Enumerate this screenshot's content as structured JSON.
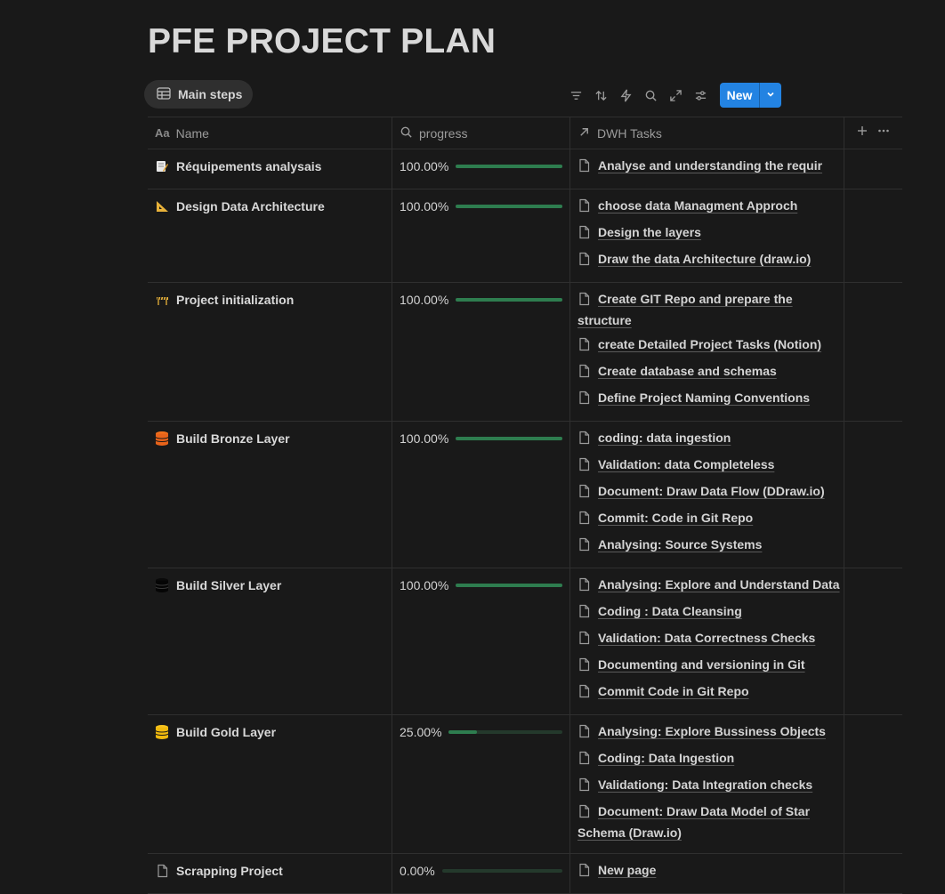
{
  "page": {
    "title": "PFE PROJECT PLAN"
  },
  "view": {
    "tab_label": "Main steps"
  },
  "toolbar": {
    "icons": [
      "filter-icon",
      "sort-icon",
      "automation-icon",
      "search-icon",
      "expand-icon",
      "settings-icon"
    ],
    "new_label": "New",
    "accent": "#2383e2"
  },
  "table": {
    "headers": {
      "name": "Name",
      "progress": "progress",
      "tasks": "DWH Tasks"
    },
    "rows": [
      {
        "icon": "memo-icon",
        "name": "Réquipements analysais",
        "progress": "100.00%",
        "progress_value": 1.0,
        "tasks": [
          "Analyse and understanding the requir"
        ]
      },
      {
        "icon": "triangle-ruler-icon",
        "name": "Design Data Architecture",
        "progress": "100.00%",
        "progress_value": 1.0,
        "tasks": [
          "choose data Managment Approch",
          "Design the layers",
          "Draw the data Architecture (draw.io)"
        ]
      },
      {
        "icon": "construction-icon",
        "name": "Project initialization",
        "progress": "100.00%",
        "progress_value": 1.0,
        "tasks": [
          "Create GIT Repo and prepare the structure",
          "create Detailed Project Tasks (Notion)",
          "Create database and schemas",
          "Define Project Naming Conventions"
        ]
      },
      {
        "icon": "database-orange-icon",
        "name": "Build Bronze Layer",
        "progress": "100.00%",
        "progress_value": 1.0,
        "tasks": [
          "coding: data ingestion",
          "Validation: data Completeless",
          "Document: Draw Data Flow (DDraw.io)",
          "Commit: Code in Git Repo",
          "Analysing: Source Systems"
        ]
      },
      {
        "icon": "database-black-icon",
        "name": "Build Silver Layer",
        "progress": "100.00%",
        "progress_value": 1.0,
        "tasks": [
          "Analysing: Explore and Understand Data",
          "Coding : Data Cleansing",
          "Validation: Data Correctness Checks",
          "Documenting and versioning in Git",
          "Commit Code in Git Repo"
        ]
      },
      {
        "icon": "database-yellow-icon",
        "name": "Build Gold Layer",
        "progress": "25.00%",
        "progress_value": 0.25,
        "tasks": [
          "Analysing: Explore Bussiness Objects",
          "Coding: Data Ingestion",
          "Validationg: Data Integration checks",
          "Document: Draw Data Model of Star Schema (Draw.io)"
        ]
      },
      {
        "icon": "page-icon",
        "name": "Scrapping Project",
        "progress": "0.00%",
        "progress_value": 0.0,
        "tasks": [
          "New page"
        ]
      }
    ]
  }
}
